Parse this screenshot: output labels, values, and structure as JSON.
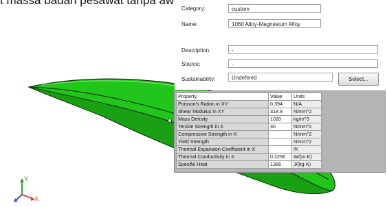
{
  "caption": "t massa badan pesawat tanpa awak yang d",
  "material_form": {
    "category": {
      "label": "Category:",
      "value": "custom"
    },
    "name": {
      "label": "Name:",
      "value": "1060 Alloy-Magnesium Alloy"
    },
    "description": {
      "label": "Description:",
      "value": "-"
    },
    "source": {
      "label": "Source:",
      "value": "-"
    },
    "sustainability": {
      "label": "Sustainability:",
      "value": "Undefined",
      "button": "Select..."
    }
  },
  "properties_table": {
    "headers": [
      "Property",
      "Value",
      "Units"
    ],
    "rows": [
      {
        "property": "Poisson's Ration in XY",
        "value": "0.394",
        "units": "N/A"
      },
      {
        "property": "Shear Modulus in XY",
        "value": "318.9",
        "units": "N/mm^2"
      },
      {
        "property": "Mass Density",
        "value": "1020",
        "units": "kg/m^3"
      },
      {
        "property": "Tensile Strength in X",
        "value": "30",
        "units": "N/mm^2"
      },
      {
        "property": "Compressive Strength in X",
        "value": "",
        "units": "N/mm^2"
      },
      {
        "property": "Yield Strength",
        "value": "",
        "units": "N/mm^2"
      },
      {
        "property": "Thermal Expansion Coefficient in X",
        "value": "",
        "units": "/K"
      },
      {
        "property": "Thermal Conductivity in X",
        "value": "0.2256",
        "units": "W/(m·K)"
      },
      {
        "property": "Specific Heat",
        "value": "1386",
        "units": "J/(kg·K)"
      }
    ]
  },
  "triad": {
    "y": "Y",
    "x": "X"
  },
  "colors": {
    "part": "#22c51a",
    "part_edge": "#0a2a08",
    "x_axis": "#e23b2e",
    "y_axis": "#2ca22c",
    "z_axis": "#2d4fd8"
  }
}
